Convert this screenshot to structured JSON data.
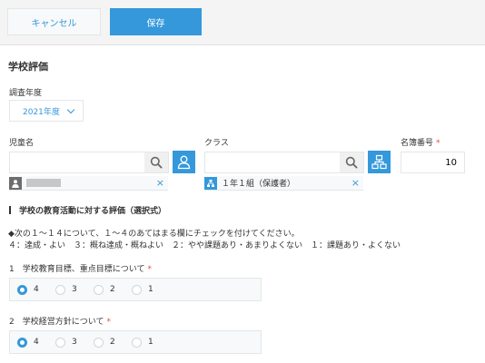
{
  "toolbar": {
    "cancel_label": "キャンセル",
    "save_label": "保存"
  },
  "form": {
    "title": "学校評価",
    "year": {
      "label": "調査年度",
      "value": "2021年度"
    },
    "student": {
      "label": "児童名",
      "value": "",
      "selected": ""
    },
    "class": {
      "label": "クラス",
      "value": "",
      "selected": "１年１組（保護者）"
    },
    "roster_no": {
      "label": "名簿番号",
      "required": "*",
      "value": "10"
    }
  },
  "section": {
    "number": "I",
    "title": "学校の教育活動に対する評価（選択式）",
    "instruction1": "◆次の１～１４について、１～４のあてはまる欄にチェックを付けてください。",
    "instruction2": "４：達成・よい　３：概ね達成・概ねよい　２：やや課題あり・あまりよくない　１：課題あり・よくない"
  },
  "questions": [
    {
      "label": "1　学校教育目標、重点目標について",
      "required": "*",
      "options": [
        "4",
        "3",
        "2",
        "1"
      ],
      "selected": "4"
    },
    {
      "label": "2　学校経営方針について",
      "required": "*",
      "options": [
        "4",
        "3",
        "2",
        "1"
      ],
      "selected": "4"
    }
  ],
  "colors": {
    "accent": "#3498db",
    "required": "#e74c3c"
  },
  "icons": [
    "search-icon",
    "user-icon",
    "org-chart-icon",
    "close-icon",
    "chevron-down-icon"
  ]
}
